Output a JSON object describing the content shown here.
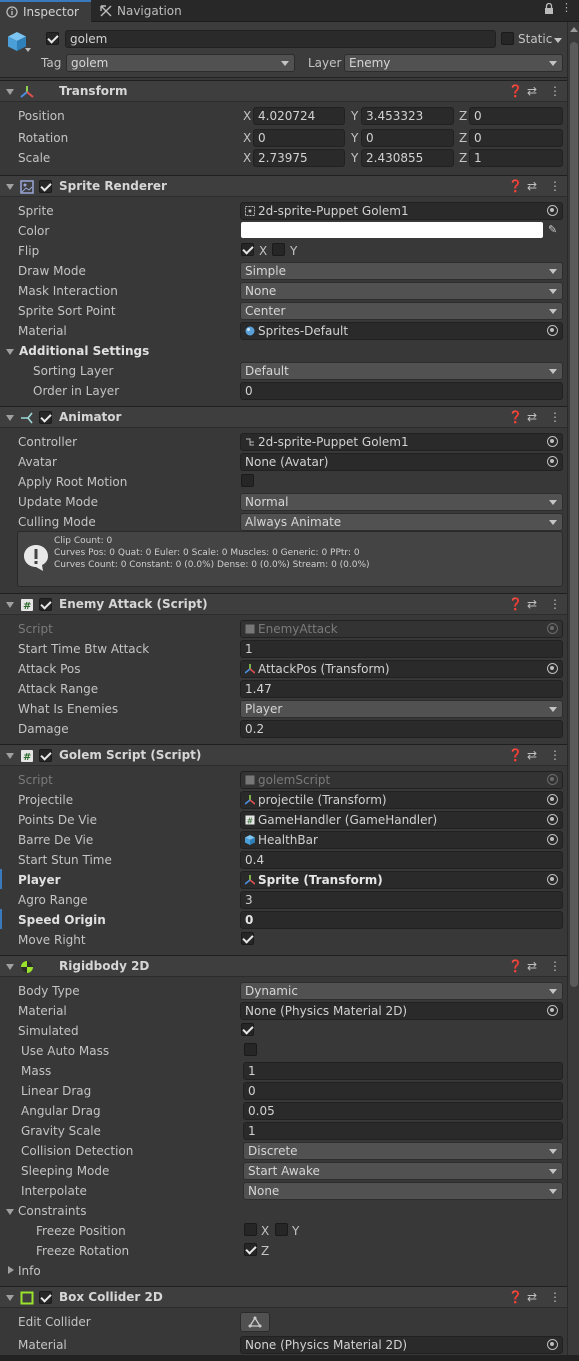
{
  "tabs": {
    "inspector": "Inspector",
    "navigation": "Navigation"
  },
  "header": {
    "name": "golem",
    "static": "Static",
    "tag_label": "Tag",
    "tag": "golem",
    "layer_label": "Layer",
    "layer": "Enemy"
  },
  "transform": {
    "title": "Transform",
    "rows": [
      {
        "label": "Position",
        "x": "4.020724",
        "y": "3.453323",
        "z": "0"
      },
      {
        "label": "Rotation",
        "x": "0",
        "y": "0",
        "z": "0"
      },
      {
        "label": "Scale",
        "x": "2.73975",
        "y": "2.430855",
        "z": "1"
      }
    ],
    "axes": {
      "x": "X",
      "y": "Y",
      "z": "Z"
    }
  },
  "sprite_renderer": {
    "title": "Sprite Renderer",
    "sprite_label": "Sprite",
    "sprite": "2d-sprite-Puppet Golem1",
    "color_label": "Color",
    "flip_label": "Flip",
    "flip_x": "X",
    "flip_y": "Y",
    "draw_mode_label": "Draw Mode",
    "draw_mode": "Simple",
    "mask_label": "Mask Interaction",
    "mask": "None",
    "sort_point_label": "Sprite Sort Point",
    "sort_point": "Center",
    "material_label": "Material",
    "material": "Sprites-Default",
    "additional": "Additional Settings",
    "sorting_layer_label": "Sorting Layer",
    "sorting_layer": "Default",
    "order_label": "Order in Layer",
    "order": "0"
  },
  "animator": {
    "title": "Animator",
    "controller_label": "Controller",
    "controller": "2d-sprite-Puppet Golem1",
    "avatar_label": "Avatar",
    "avatar": "None (Avatar)",
    "root_motion_label": "Apply Root Motion",
    "update_label": "Update Mode",
    "update": "Normal",
    "culling_label": "Culling Mode",
    "culling": "Always Animate",
    "info": [
      "Clip Count: 0",
      "Curves Pos: 0 Quat: 0 Euler: 0 Scale: 0 Muscles: 0 Generic: 0 PPtr: 0",
      "Curves Count: 0 Constant: 0 (0.0%) Dense: 0 (0.0%) Stream: 0 (0.0%)"
    ]
  },
  "enemy_attack": {
    "title": "Enemy Attack (Script)",
    "script_label": "Script",
    "script": "EnemyAttack",
    "start_time_label": "Start Time Btw Attack",
    "start_time": "1",
    "attack_pos_label": "Attack Pos",
    "attack_pos": "AttackPos (Transform)",
    "attack_range_label": "Attack Range",
    "attack_range": "1.47",
    "what_is_label": "What Is Enemies",
    "what_is": "Player",
    "damage_label": "Damage",
    "damage": "0.2"
  },
  "golem_script": {
    "title": "Golem Script (Script)",
    "script_label": "Script",
    "script": "golemScript",
    "projectile_label": "Projectile",
    "projectile": "projectile (Transform)",
    "points_label": "Points De Vie",
    "points": "GameHandler (GameHandler)",
    "barre_label": "Barre De Vie",
    "barre": "HealthBar",
    "stun_label": "Start Stun Time",
    "stun": "0.4",
    "player_label": "Player",
    "player": "Sprite (Transform)",
    "agro_label": "Agro Range",
    "agro": "3",
    "speed_label": "Speed Origin",
    "speed": "0",
    "move_label": "Move Right"
  },
  "rigidbody": {
    "title": "Rigidbody 2D",
    "body_type_label": "Body Type",
    "body_type": "Dynamic",
    "material_label": "Material",
    "material": "None (Physics Material 2D)",
    "simulated_label": "Simulated",
    "auto_mass_label": "Use Auto Mass",
    "mass_label": "Mass",
    "mass": "1",
    "linear_label": "Linear Drag",
    "linear": "0",
    "angular_label": "Angular Drag",
    "angular": "0.05",
    "gravity_label": "Gravity Scale",
    "gravity": "1",
    "collision_label": "Collision Detection",
    "collision": "Discrete",
    "sleeping_label": "Sleeping Mode",
    "sleeping": "Start Awake",
    "interpolate_label": "Interpolate",
    "interpolate": "None",
    "constraints_label": "Constraints",
    "freeze_pos_label": "Freeze Position",
    "freeze_rot_label": "Freeze Rotation",
    "x": "X",
    "y": "Y",
    "z": "Z",
    "info_label": "Info"
  },
  "box_collider": {
    "title": "Box Collider 2D",
    "edit_label": "Edit Collider",
    "material_label": "Material",
    "material": "None (Physics Material 2D)"
  },
  "colors": {
    "accent": "#3a79bb",
    "background": "#383838",
    "field": "#2a2a2a"
  }
}
